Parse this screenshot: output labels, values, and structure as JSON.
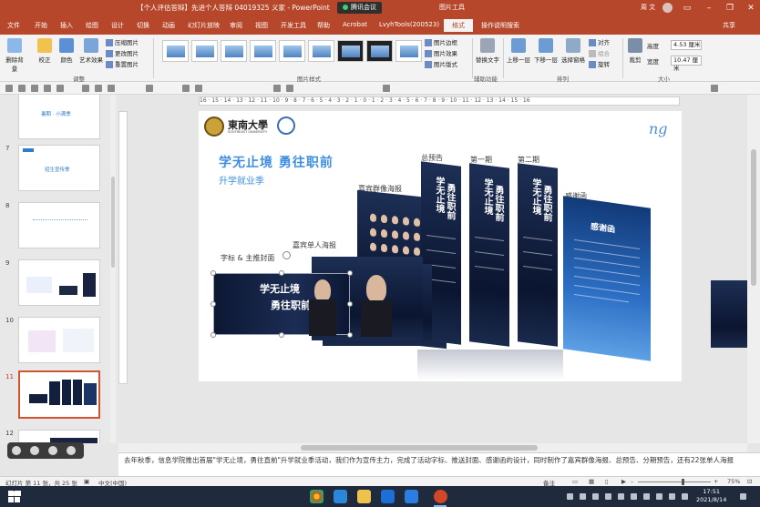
{
  "titlebar": {
    "doc_title": "【个人评估答辩】先进个人答辩 04019325 义家 - PowerPoint",
    "meeting_label": "腾讯会议",
    "context_tab": "图片工具",
    "user_name": "周 文"
  },
  "tabs": [
    "文件",
    "开始",
    "插入",
    "绘图",
    "设计",
    "切换",
    "动画",
    "幻灯片放映",
    "审阅",
    "视图",
    "开发工具",
    "帮助",
    "Acrobat",
    "LvyhTools(200523)",
    "格式"
  ],
  "active_tab_index": 14,
  "tell_me": "操作说明搜索",
  "share_label": "共享",
  "ribbon": {
    "remove_bg": "删除背景",
    "corrections": "校正",
    "color": "颜色",
    "artistic": "艺术效果",
    "compress": "压缩图片",
    "change_pic": "更改图片",
    "reset_pic": "重置图片",
    "group_adjust": "调整",
    "group_styles": "图片样式",
    "pic_border": "图片边框",
    "pic_effects": "图片效果",
    "pic_layout": "图片版式",
    "alt_text": "替换文字",
    "group_access": "辅助功能",
    "bring_forward": "上移一层",
    "send_backward": "下移一层",
    "selection_pane": "选择窗格",
    "align": "对齐",
    "group_obj": "组合",
    "rotate": "旋转",
    "group_arrange": "排列",
    "crop": "裁剪",
    "height_label": "高度",
    "height_value": "4.53 厘米",
    "width_label": "宽度",
    "width_value": "10.47 厘米",
    "group_size": "大小"
  },
  "thumbnails": {
    "slide_numbers": [
      "7",
      "8",
      "9",
      "10",
      "11",
      "12"
    ],
    "selected": "11",
    "t6_text": "暑期 · 小满季",
    "t7_text": "招生宣传季"
  },
  "ruler_text": "16 · 15 · 14 · 13 · 12 · 11 · 10 · 9 · 8 · 7 · 6 · 5 · 4 · 3 · 2 · 1 · 0 · 1 · 2 · 3 · 4 · 5 · 6 · 7 · 8 · 9 · 10 · 11 · 12 · 13 · 14 · 15 · 16",
  "slide": {
    "university": "東南大學",
    "university_en": "SOUTHEAST UNIVERSITY",
    "heading": "学无止境 勇往职前",
    "subheading": "升学就业季",
    "label_forecast": "总预告",
    "label_period1": "第一期",
    "label_period2": "第二期",
    "label_thanks": "感谢函",
    "label_guest": "嘉宾群像海报",
    "label_single": "嘉宾单人海报",
    "label_cover": "字标 & 主推封面",
    "poster_v1": "学无止境",
    "poster_v2": "勇往职前",
    "thanks_title": "感谢函",
    "logo_mark": "ng"
  },
  "notes": "去年秋季，信息学院推出首届\"学无止境，勇往直前\"升学就业季活动，我们作为宣传主力，完成了活动字标、推送封面、感谢函的设计，同时制作了嘉宾群像海报、总预告、分期预告，还有22张单人海报",
  "status": {
    "slide_info": "幻灯片 第 11 张，共 25 张",
    "language": "中文(中国)",
    "notes_btn": "备注",
    "zoom": "75%"
  },
  "taskbar": {
    "time": "17:51",
    "date": "2021/8/14"
  }
}
